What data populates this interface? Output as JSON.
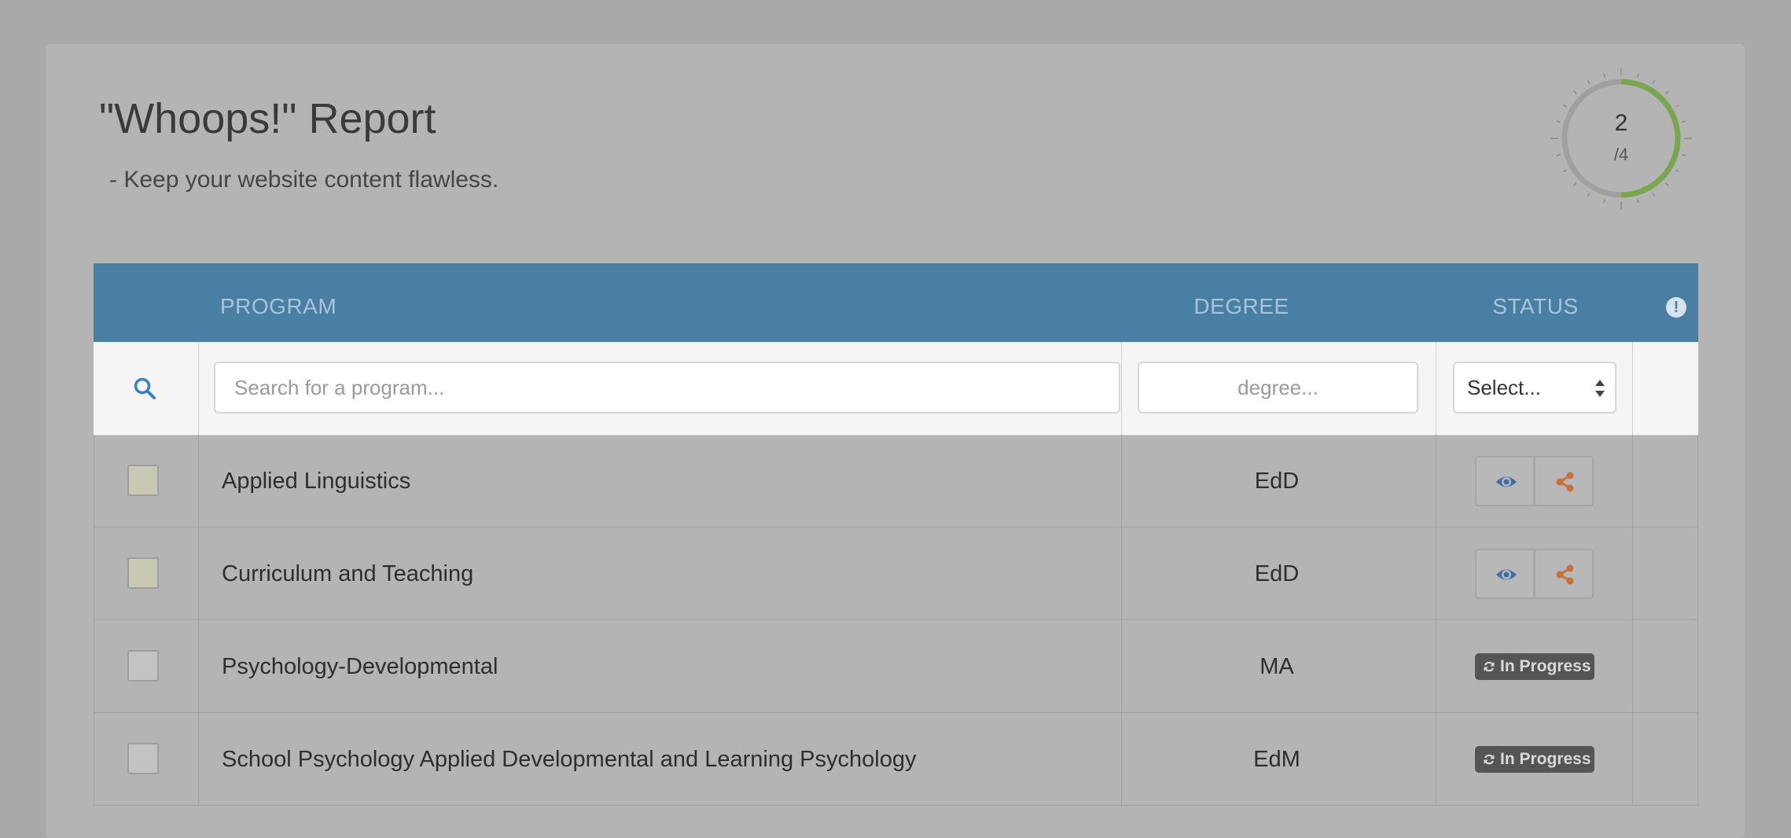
{
  "page": {
    "title": "\"Whoops!\" Report",
    "subtitle": "- Keep your website content flawless."
  },
  "progress": {
    "current": "2",
    "total": "/4",
    "fraction": 0.5,
    "color": "#7aa64f"
  },
  "table": {
    "headers": {
      "program": "PROGRAM",
      "degree": "DEGREE",
      "status": "STATUS"
    },
    "filters": {
      "program_placeholder": "Search for a program...",
      "degree_placeholder": "degree...",
      "status_selected": "Select..."
    },
    "rows": [
      {
        "program": "Applied Linguistics",
        "degree": "EdD",
        "checked": true,
        "status": "actions"
      },
      {
        "program": "Curriculum and Teaching",
        "degree": "EdD",
        "checked": true,
        "status": "actions"
      },
      {
        "program": "Psychology-Developmental",
        "degree": "MA",
        "checked": false,
        "status": "In Progress"
      },
      {
        "program": "School Psychology Applied Developmental and Learning Psychology",
        "degree": "EdM",
        "checked": false,
        "status": "In Progress"
      }
    ]
  },
  "colors": {
    "header": "#4a7fa4",
    "view_icon": "#3f6fa6",
    "share_icon": "#c7703a",
    "badge": "#555555"
  },
  "icons": {
    "search": "search-icon",
    "info": "info-icon",
    "view": "eye-icon",
    "share": "share-icon",
    "status": "refresh-icon"
  }
}
